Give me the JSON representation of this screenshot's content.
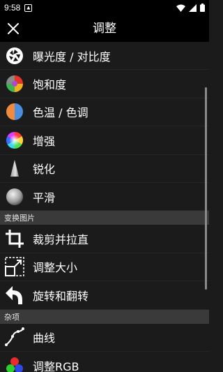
{
  "status_bar": {
    "time": "9:58"
  },
  "app_bar": {
    "title": "调整"
  },
  "adjust_items": [
    {
      "label": "曝光度 / 对比度",
      "icon": "aperture-icon"
    },
    {
      "label": "饱和度",
      "icon": "color-wheel-icon"
    },
    {
      "label": "色温 / 色调",
      "icon": "warm-cool-circle-icon"
    },
    {
      "label": "增强",
      "icon": "rainbow-circle-icon"
    },
    {
      "label": "锐化",
      "icon": "cone-icon"
    },
    {
      "label": "平滑",
      "icon": "sphere-icon"
    }
  ],
  "sections": {
    "transform": "变换图片",
    "misc": "杂项"
  },
  "transform_items": [
    {
      "label": "裁剪并拉直",
      "icon": "crop-icon"
    },
    {
      "label": "调整大小",
      "icon": "resize-icon"
    },
    {
      "label": "旋转和翻转",
      "icon": "rotate-icon"
    }
  ],
  "misc_items": [
    {
      "label": "曲线",
      "icon": "curve-icon"
    },
    {
      "label": "调整RGB",
      "icon": "rgb-circles-icon"
    }
  ]
}
